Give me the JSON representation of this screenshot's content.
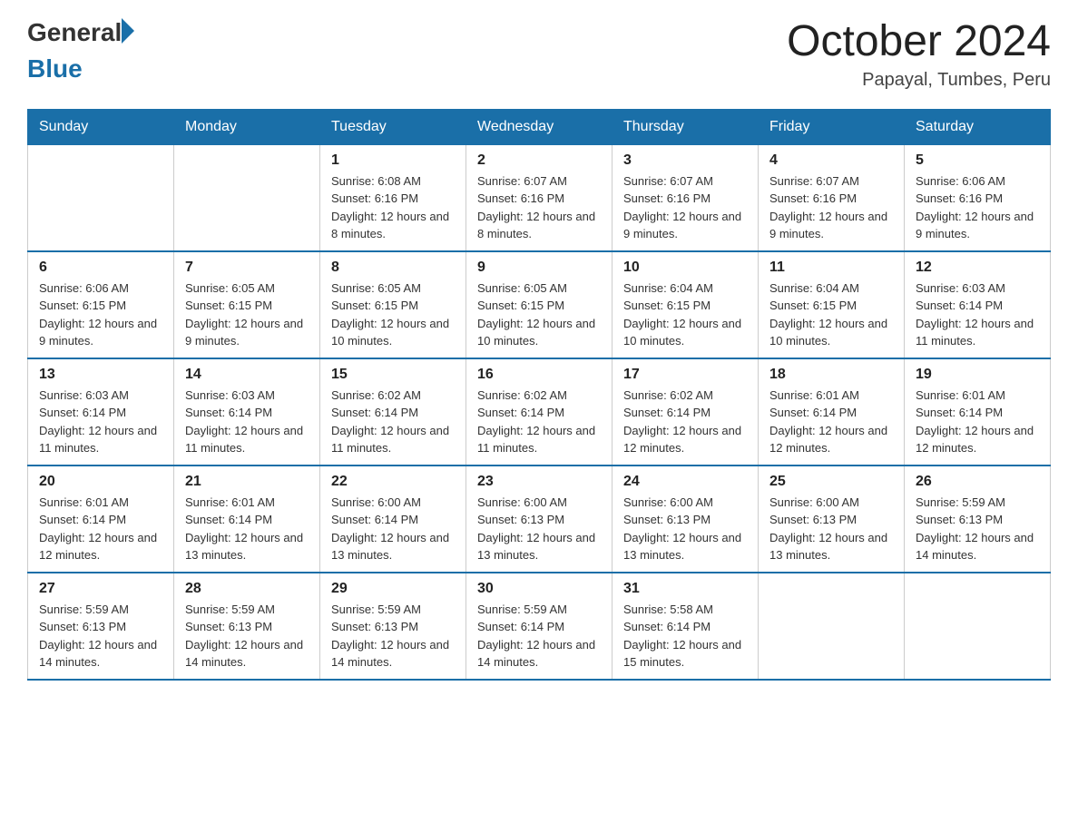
{
  "logo": {
    "general": "General",
    "blue": "Blue"
  },
  "header": {
    "month": "October 2024",
    "location": "Papayal, Tumbes, Peru"
  },
  "days_of_week": [
    "Sunday",
    "Monday",
    "Tuesday",
    "Wednesday",
    "Thursday",
    "Friday",
    "Saturday"
  ],
  "weeks": [
    [
      {
        "day": "",
        "info": ""
      },
      {
        "day": "",
        "info": ""
      },
      {
        "day": "1",
        "info": "Sunrise: 6:08 AM\nSunset: 6:16 PM\nDaylight: 12 hours and 8 minutes."
      },
      {
        "day": "2",
        "info": "Sunrise: 6:07 AM\nSunset: 6:16 PM\nDaylight: 12 hours and 8 minutes."
      },
      {
        "day": "3",
        "info": "Sunrise: 6:07 AM\nSunset: 6:16 PM\nDaylight: 12 hours and 9 minutes."
      },
      {
        "day": "4",
        "info": "Sunrise: 6:07 AM\nSunset: 6:16 PM\nDaylight: 12 hours and 9 minutes."
      },
      {
        "day": "5",
        "info": "Sunrise: 6:06 AM\nSunset: 6:16 PM\nDaylight: 12 hours and 9 minutes."
      }
    ],
    [
      {
        "day": "6",
        "info": "Sunrise: 6:06 AM\nSunset: 6:15 PM\nDaylight: 12 hours and 9 minutes."
      },
      {
        "day": "7",
        "info": "Sunrise: 6:05 AM\nSunset: 6:15 PM\nDaylight: 12 hours and 9 minutes."
      },
      {
        "day": "8",
        "info": "Sunrise: 6:05 AM\nSunset: 6:15 PM\nDaylight: 12 hours and 10 minutes."
      },
      {
        "day": "9",
        "info": "Sunrise: 6:05 AM\nSunset: 6:15 PM\nDaylight: 12 hours and 10 minutes."
      },
      {
        "day": "10",
        "info": "Sunrise: 6:04 AM\nSunset: 6:15 PM\nDaylight: 12 hours and 10 minutes."
      },
      {
        "day": "11",
        "info": "Sunrise: 6:04 AM\nSunset: 6:15 PM\nDaylight: 12 hours and 10 minutes."
      },
      {
        "day": "12",
        "info": "Sunrise: 6:03 AM\nSunset: 6:14 PM\nDaylight: 12 hours and 11 minutes."
      }
    ],
    [
      {
        "day": "13",
        "info": "Sunrise: 6:03 AM\nSunset: 6:14 PM\nDaylight: 12 hours and 11 minutes."
      },
      {
        "day": "14",
        "info": "Sunrise: 6:03 AM\nSunset: 6:14 PM\nDaylight: 12 hours and 11 minutes."
      },
      {
        "day": "15",
        "info": "Sunrise: 6:02 AM\nSunset: 6:14 PM\nDaylight: 12 hours and 11 minutes."
      },
      {
        "day": "16",
        "info": "Sunrise: 6:02 AM\nSunset: 6:14 PM\nDaylight: 12 hours and 11 minutes."
      },
      {
        "day": "17",
        "info": "Sunrise: 6:02 AM\nSunset: 6:14 PM\nDaylight: 12 hours and 12 minutes."
      },
      {
        "day": "18",
        "info": "Sunrise: 6:01 AM\nSunset: 6:14 PM\nDaylight: 12 hours and 12 minutes."
      },
      {
        "day": "19",
        "info": "Sunrise: 6:01 AM\nSunset: 6:14 PM\nDaylight: 12 hours and 12 minutes."
      }
    ],
    [
      {
        "day": "20",
        "info": "Sunrise: 6:01 AM\nSunset: 6:14 PM\nDaylight: 12 hours and 12 minutes."
      },
      {
        "day": "21",
        "info": "Sunrise: 6:01 AM\nSunset: 6:14 PM\nDaylight: 12 hours and 13 minutes."
      },
      {
        "day": "22",
        "info": "Sunrise: 6:00 AM\nSunset: 6:14 PM\nDaylight: 12 hours and 13 minutes."
      },
      {
        "day": "23",
        "info": "Sunrise: 6:00 AM\nSunset: 6:13 PM\nDaylight: 12 hours and 13 minutes."
      },
      {
        "day": "24",
        "info": "Sunrise: 6:00 AM\nSunset: 6:13 PM\nDaylight: 12 hours and 13 minutes."
      },
      {
        "day": "25",
        "info": "Sunrise: 6:00 AM\nSunset: 6:13 PM\nDaylight: 12 hours and 13 minutes."
      },
      {
        "day": "26",
        "info": "Sunrise: 5:59 AM\nSunset: 6:13 PM\nDaylight: 12 hours and 14 minutes."
      }
    ],
    [
      {
        "day": "27",
        "info": "Sunrise: 5:59 AM\nSunset: 6:13 PM\nDaylight: 12 hours and 14 minutes."
      },
      {
        "day": "28",
        "info": "Sunrise: 5:59 AM\nSunset: 6:13 PM\nDaylight: 12 hours and 14 minutes."
      },
      {
        "day": "29",
        "info": "Sunrise: 5:59 AM\nSunset: 6:13 PM\nDaylight: 12 hours and 14 minutes."
      },
      {
        "day": "30",
        "info": "Sunrise: 5:59 AM\nSunset: 6:14 PM\nDaylight: 12 hours and 14 minutes."
      },
      {
        "day": "31",
        "info": "Sunrise: 5:58 AM\nSunset: 6:14 PM\nDaylight: 12 hours and 15 minutes."
      },
      {
        "day": "",
        "info": ""
      },
      {
        "day": "",
        "info": ""
      }
    ]
  ],
  "colors": {
    "header_bg": "#1a6fa8",
    "header_text": "#ffffff",
    "border": "#1a6fa8",
    "text": "#333333"
  }
}
